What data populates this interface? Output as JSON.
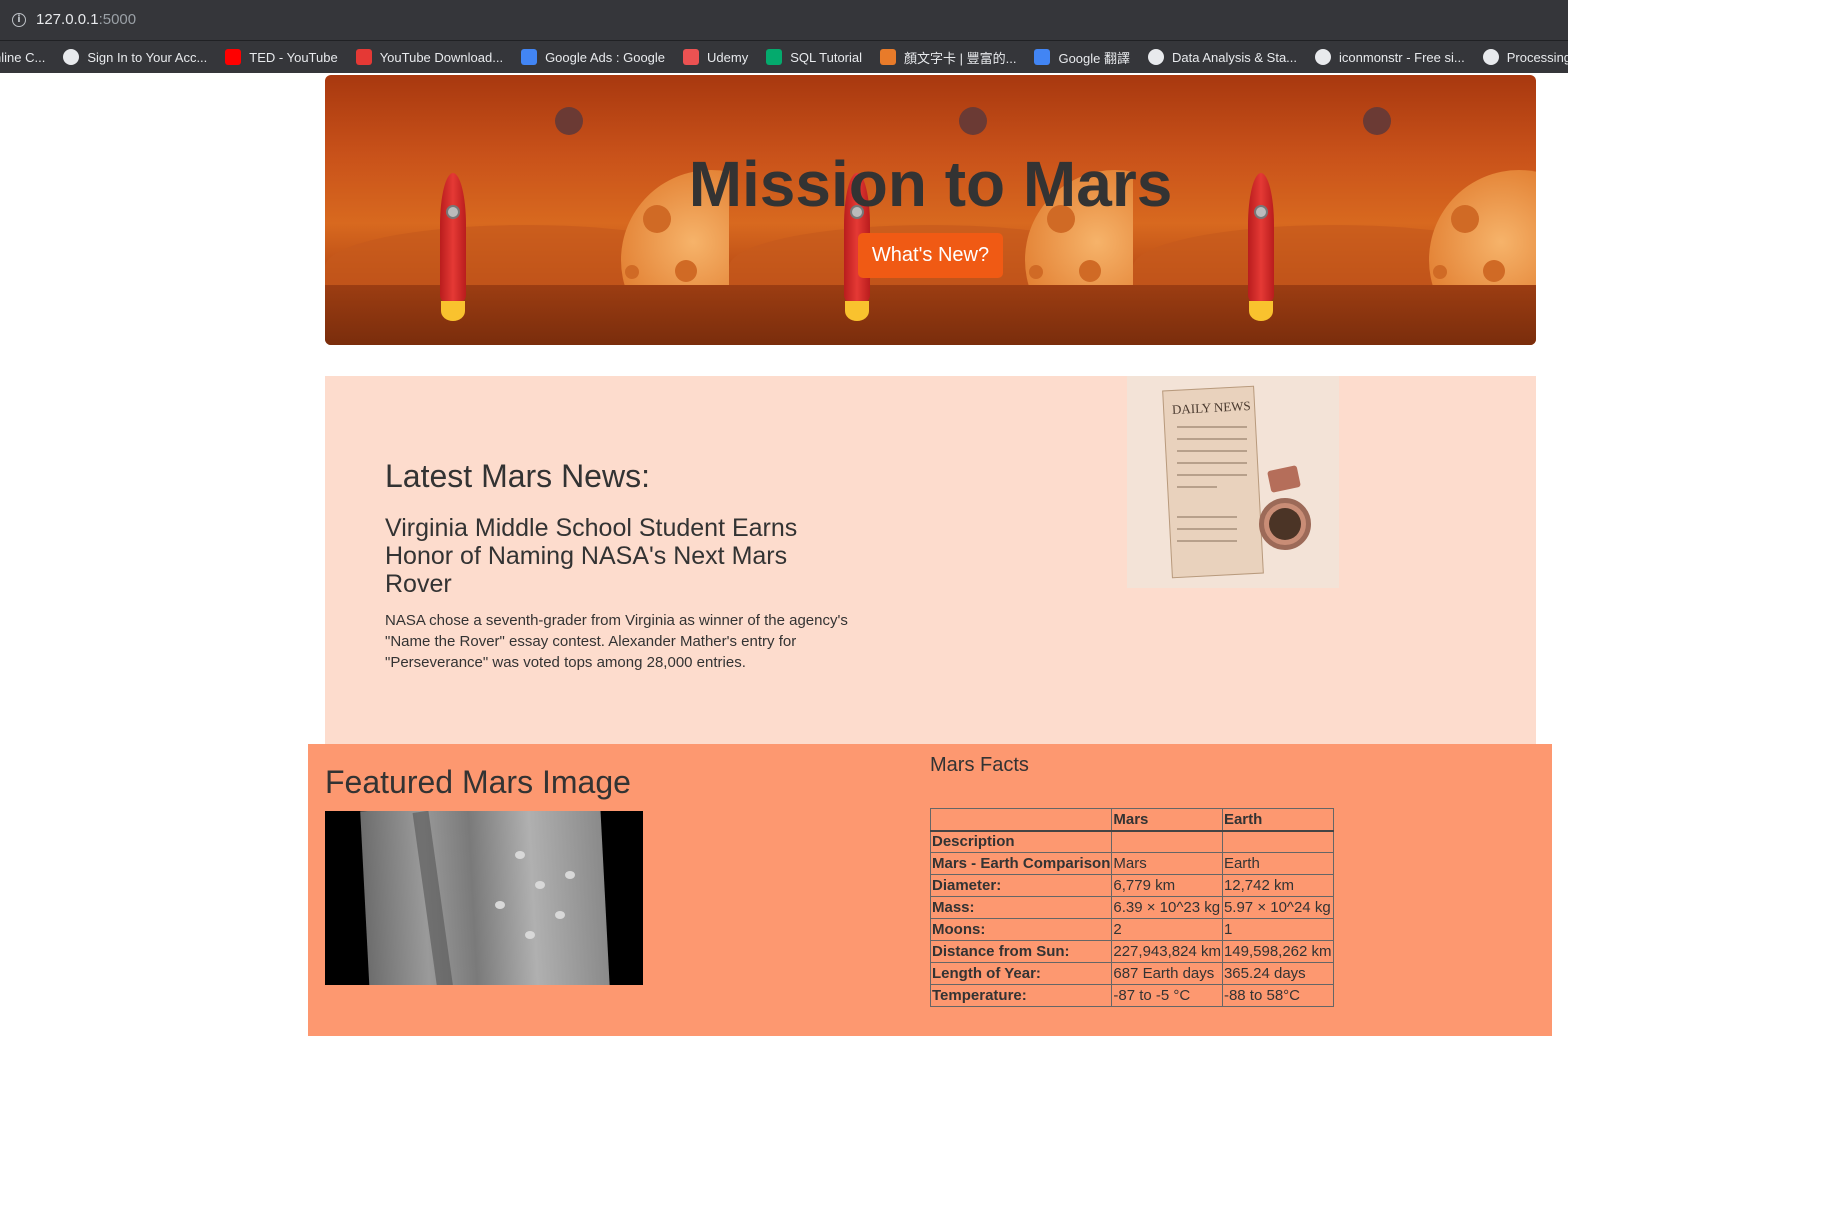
{
  "browser": {
    "url_host": "127.0.0.1",
    "url_port": ":5000",
    "bookmarks": [
      {
        "label": "nline C...",
        "icon": "",
        "color": "#35363a"
      },
      {
        "label": "Sign In to Your Acc...",
        "icon": "globe-icon",
        "color": "#e8eaed"
      },
      {
        "label": "TED - YouTube",
        "icon": "youtube-icon",
        "color": "#ff0000"
      },
      {
        "label": "YouTube Download...",
        "icon": "download-icon",
        "color": "#e53935"
      },
      {
        "label": "Google Ads : Google",
        "icon": "google-icon",
        "color": "#4285f4"
      },
      {
        "label": "Udemy",
        "icon": "udemy-icon",
        "color": "#ec5252"
      },
      {
        "label": "SQL Tutorial",
        "icon": "w3schools-icon",
        "color": "#04aa6d"
      },
      {
        "label": "顏文字卡 | 豐富的...",
        "icon": "card-icon",
        "color": "#e87b2a"
      },
      {
        "label": "Google 翻譯",
        "icon": "translate-icon",
        "color": "#4285f4"
      },
      {
        "label": "Data Analysis & Sta...",
        "icon": "edx-icon",
        "color": "#e8eaed"
      },
      {
        "label": "iconmonstr - Free si...",
        "icon": "iconmonstr-icon",
        "color": "#e8eaed"
      },
      {
        "label": "Processing Times",
        "icon": "shield-icon",
        "color": "#e8eaed"
      }
    ]
  },
  "jumbotron": {
    "title": "Mission to Mars",
    "button_label": "What's New?"
  },
  "news": {
    "heading": "Latest Mars News:",
    "headline": "Virginia Middle School Student Earns Honor of Naming NASA's Next Mars Rover",
    "teaser": "NASA chose a seventh-grader from Virginia as winner of the agency's \"Name the Rover\" essay contest. Alexander Mather's entry for \"Perseverance\" was voted tops among 28,000 entries.",
    "image_text": "DAILY NEWS"
  },
  "featured": {
    "heading": "Featured Mars Image"
  },
  "facts": {
    "title": "Mars Facts",
    "columns": [
      "",
      "Mars",
      "Earth"
    ],
    "rows": [
      {
        "label": "Description",
        "mars": "",
        "earth": ""
      },
      {
        "label": "Mars - Earth Comparison",
        "mars": "Mars",
        "earth": "Earth"
      },
      {
        "label": "Diameter:",
        "mars": "6,779 km",
        "earth": "12,742 km"
      },
      {
        "label": "Mass:",
        "mars": "6.39 × 10^23 kg",
        "earth": "5.97 × 10^24 kg"
      },
      {
        "label": "Moons:",
        "mars": "2",
        "earth": "1"
      },
      {
        "label": "Distance from Sun:",
        "mars": "227,943,824 km",
        "earth": "149,598,262 km"
      },
      {
        "label": "Length of Year:",
        "mars": "687 Earth days",
        "earth": "365.24 days"
      },
      {
        "label": "Temperature:",
        "mars": "-87 to -5 °C",
        "earth": "-88 to 58°C"
      }
    ]
  }
}
